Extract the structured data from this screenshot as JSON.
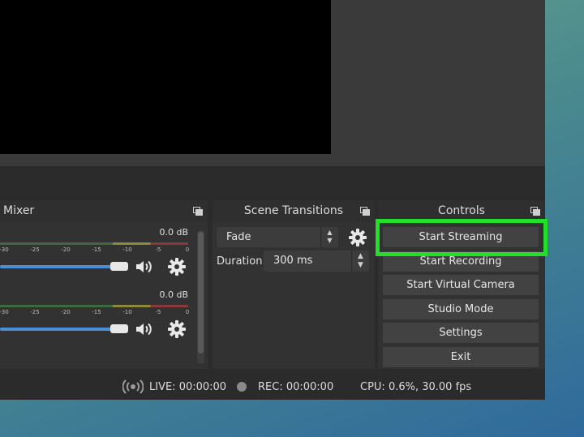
{
  "mixer": {
    "title": "Mixer",
    "channels": [
      {
        "db": "0.0 dB",
        "level": 0,
        "volume": 1.0
      },
      {
        "db": "0.0 dB",
        "level": 0,
        "volume": 1.0
      }
    ],
    "ticks": [
      "-30",
      "-25",
      "-20",
      "-15",
      "-10",
      "-5",
      "0"
    ]
  },
  "transitions": {
    "title": "Scene Transitions",
    "selected": "Fade",
    "duration_label": "Duration",
    "duration_value": "300 ms"
  },
  "controls": {
    "title": "Controls",
    "buttons": [
      "Start Streaming",
      "Start Recording",
      "Start Virtual Camera",
      "Studio Mode",
      "Settings",
      "Exit"
    ]
  },
  "status": {
    "live": "LIVE: 00:00:00",
    "rec": "REC: 00:00:00",
    "cpu": "CPU: 0.6%, 30.00 fps"
  },
  "colors": {
    "highlight": "#22e02a",
    "volume_slider": "#4a90d9",
    "panel": "#323232"
  },
  "icons": {
    "volume": "speaker-icon",
    "settings": "gear-icon",
    "float": "float-dock-icon",
    "broadcast": "broadcast-icon",
    "record": "record-dot-icon"
  }
}
